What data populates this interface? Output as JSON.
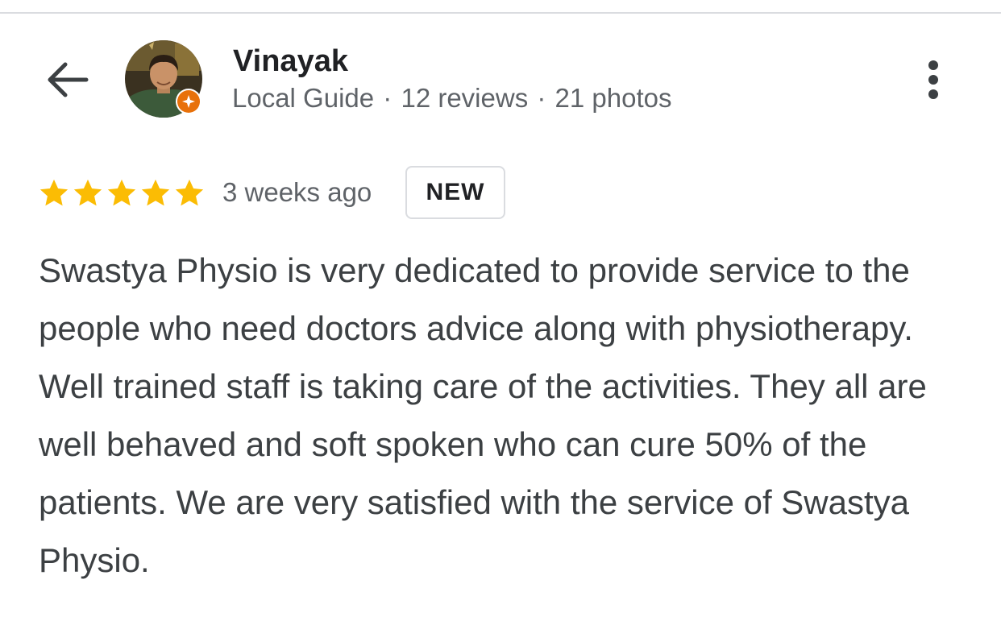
{
  "header": {
    "back_icon": "arrow-back-icon",
    "more_icon": "more-vertical-icon"
  },
  "reviewer": {
    "name": "Vinayak",
    "avatar_icon": "profile-photo",
    "badge_icon": "local-guide-badge-icon",
    "badge_color": "#e8710a",
    "level": "Local Guide",
    "separator": "·",
    "reviews": "12 reviews",
    "photos": "21 photos"
  },
  "rating": {
    "stars": 5,
    "max_stars": 5,
    "star_color": "#fbbc04",
    "time_ago": "3 weeks ago",
    "badge": "NEW"
  },
  "review": {
    "text": "Swastya Physio is very dedicated to provide service to the people who need doctors advice along with physiotherapy. Well trained staff is taking care of the activities. They all are well behaved and soft spoken who can cure 50% of the patients. We are very satisfied with the service of Swastya Physio."
  }
}
